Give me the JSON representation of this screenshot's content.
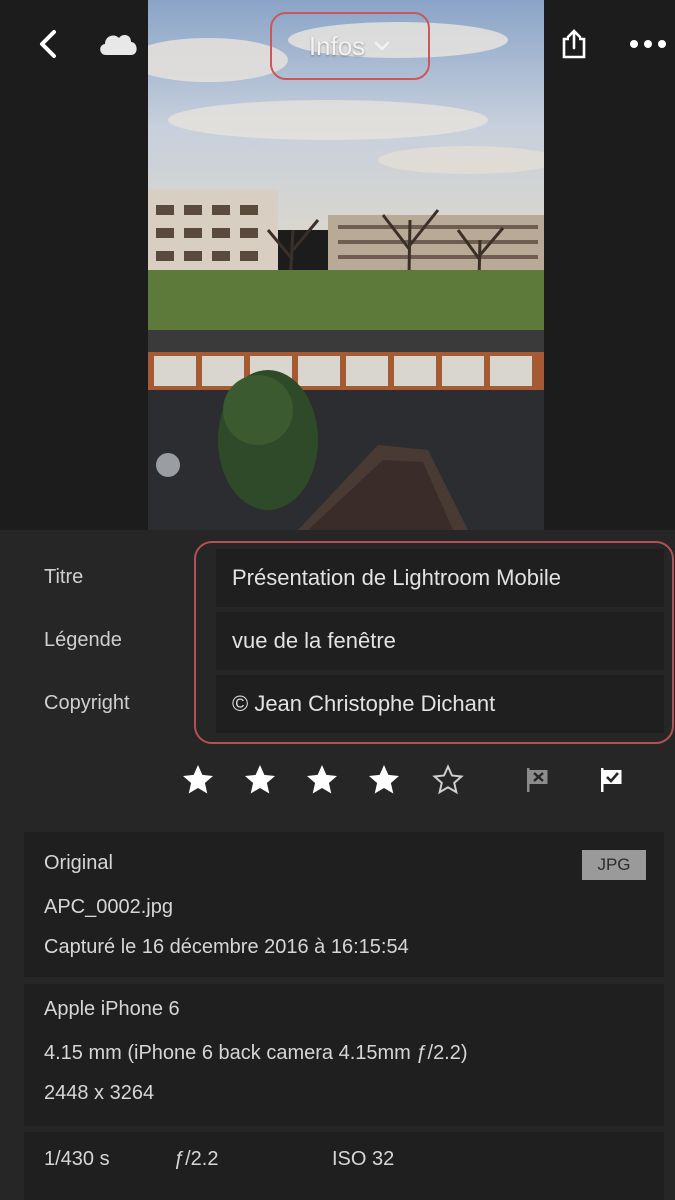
{
  "header": {
    "title": "Infos",
    "icons": [
      "back-icon",
      "cloud-icon",
      "chevron-down-icon",
      "share-icon",
      "more-icon"
    ]
  },
  "metadata": {
    "title_label": "Titre",
    "title_value": "Présentation de Lightroom Mobile",
    "caption_label": "Légende",
    "caption_value": "vue de la fenêtre",
    "copyright_label": "Copyright",
    "copyright_value": "© Jean Christophe Dichant"
  },
  "rating": {
    "stars": 4,
    "max": 5,
    "flags": [
      "reject-flag-icon",
      "pick-flag-icon"
    ]
  },
  "file_info": {
    "type_label": "Original",
    "filename": "APC_0002.jpg",
    "captured": "Capturé le 16 décembre 2016 à 16:15:54",
    "format_badge": "JPG"
  },
  "camera_info": {
    "camera": "Apple iPhone 6",
    "lens": "4.15 mm (iPhone 6 back camera 4.15mm ƒ/2.2)",
    "dimensions": "2448 x 3264"
  },
  "exposure": {
    "shutter": "1/430 s",
    "aperture": "ƒ/2.2",
    "iso": "ISO 32"
  },
  "colors": {
    "highlight": "#c8585a",
    "background": "#262626",
    "panel": "#1f1f1f"
  }
}
